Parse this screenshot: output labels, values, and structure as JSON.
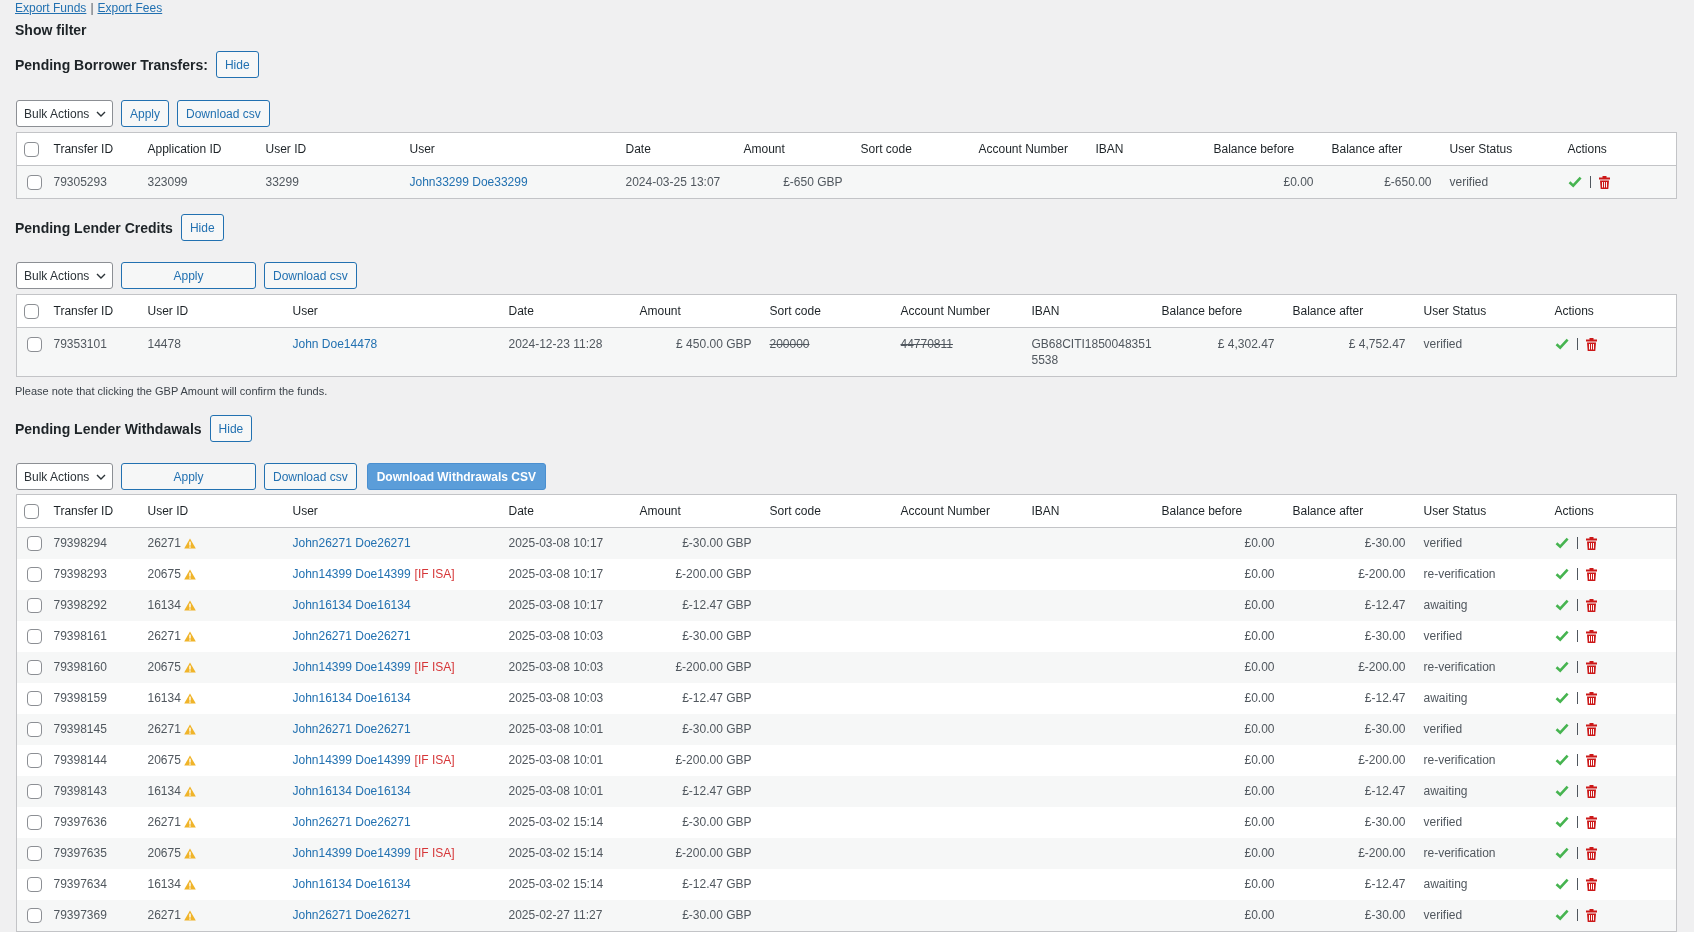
{
  "export_links": {
    "items": [
      "Export Funds",
      "Export Fees"
    ],
    "separator": "|"
  },
  "filter_toggle": "Show filter",
  "sections": [
    {
      "title": "Pending Borrower Transfers:",
      "hide_button": "Hide",
      "bulk_actions": "Bulk Actions",
      "buttons": [
        {
          "label": "Apply",
          "kind": "apply"
        },
        {
          "label": "Download csv",
          "kind": "download"
        }
      ],
      "table": {
        "select_all_checked": false,
        "columns": [
          "Transfer ID",
          "Application ID",
          "User ID",
          "User",
          "Date",
          "Amount",
          "Sort code",
          "Account Number",
          "IBAN",
          "Balance before",
          "Balance after",
          "User Status",
          "Actions"
        ],
        "rows": [
          {
            "checked": false,
            "transfer_id": "79305293",
            "application_id": "323099",
            "user_id": "33299",
            "user": "John33299 Doe33299",
            "date": "2024-03-25 13:07",
            "amount": "£-650 GBP",
            "balance_before": "£0.00",
            "balance_after": "£-650.00",
            "status": "verified"
          }
        ]
      }
    },
    {
      "title": "Pending Lender Credits",
      "hide_button": "Hide",
      "bulk_actions": "Bulk Actions",
      "buttons": [
        {
          "label": "Apply",
          "kind": "apply"
        },
        {
          "label": "Download csv",
          "kind": "download"
        }
      ],
      "table": {
        "select_all_checked": false,
        "columns": [
          "Transfer ID",
          "User ID",
          "User",
          "Date",
          "Amount",
          "Sort code",
          "Account Number",
          "IBAN",
          "Balance before",
          "Balance after",
          "User Status",
          "Actions"
        ],
        "rows": [
          {
            "checked": false,
            "transfer_id": "79353101",
            "user_id": "14478",
            "user": "John Doe14478",
            "date": "2024-12-23 11:28",
            "amount": "£ 450.00 GBP",
            "sort_code": "200000",
            "sort_code_struck": true,
            "account_number": "44770811",
            "account_number_struck": true,
            "iban": "GB68CITI18500483515538",
            "balance_before": "£ 4,302.47",
            "balance_after": "£ 4,752.47",
            "status": "verified"
          }
        ]
      },
      "note": "Please note that clicking the GBP Amount will confirm the funds."
    },
    {
      "title": "Pending Lender Withdawals",
      "hide_button": "Hide",
      "bulk_actions": "Bulk Actions",
      "buttons": [
        {
          "label": "Apply",
          "kind": "apply"
        },
        {
          "label": "Download csv",
          "kind": "download"
        },
        {
          "label": "Download Withdrawals CSV",
          "kind": "download_primary"
        }
      ],
      "table": {
        "select_all_checked": false,
        "columns": [
          "Transfer ID",
          "User ID",
          "User",
          "Date",
          "Amount",
          "Sort code",
          "Account Number",
          "IBAN",
          "Balance before",
          "Balance after",
          "User Status",
          "Actions"
        ],
        "rows": [
          {
            "checked": false,
            "transfer_id": "79398294",
            "user_id": "26271",
            "user_id_warning": true,
            "user": "John26271 Doe26271",
            "date": "2025-03-08 10:17",
            "amount": "£-30.00 GBP",
            "balance_before": "£0.00",
            "balance_after": "£-30.00",
            "status": "verified"
          },
          {
            "checked": false,
            "transfer_id": "79398293",
            "user_id": "20675",
            "user_id_warning": true,
            "user": "John14399 Doe14399",
            "user_tag": "[IF ISA]",
            "date": "2025-03-08 10:17",
            "amount": "£-200.00 GBP",
            "balance_before": "£0.00",
            "balance_after": "£-200.00",
            "status": "re-verification"
          },
          {
            "checked": false,
            "transfer_id": "79398292",
            "user_id": "16134",
            "user_id_warning": true,
            "user": "John16134 Doe16134",
            "date": "2025-03-08 10:17",
            "amount": "£-12.47 GBP",
            "balance_before": "£0.00",
            "balance_after": "£-12.47",
            "status": "awaiting"
          },
          {
            "checked": false,
            "transfer_id": "79398161",
            "user_id": "26271",
            "user_id_warning": true,
            "user": "John26271 Doe26271",
            "date": "2025-03-08 10:03",
            "amount": "£-30.00 GBP",
            "balance_before": "£0.00",
            "balance_after": "£-30.00",
            "status": "verified"
          },
          {
            "checked": false,
            "transfer_id": "79398160",
            "user_id": "20675",
            "user_id_warning": true,
            "user": "John14399 Doe14399",
            "user_tag": "[IF ISA]",
            "date": "2025-03-08 10:03",
            "amount": "£-200.00 GBP",
            "balance_before": "£0.00",
            "balance_after": "£-200.00",
            "status": "re-verification"
          },
          {
            "checked": false,
            "transfer_id": "79398159",
            "user_id": "16134",
            "user_id_warning": true,
            "user": "John16134 Doe16134",
            "date": "2025-03-08 10:03",
            "amount": "£-12.47 GBP",
            "balance_before": "£0.00",
            "balance_after": "£-12.47",
            "status": "awaiting"
          },
          {
            "checked": false,
            "transfer_id": "79398145",
            "user_id": "26271",
            "user_id_warning": true,
            "user": "John26271 Doe26271",
            "date": "2025-03-08 10:01",
            "amount": "£-30.00 GBP",
            "balance_before": "£0.00",
            "balance_after": "£-30.00",
            "status": "verified"
          },
          {
            "checked": false,
            "transfer_id": "79398144",
            "user_id": "20675",
            "user_id_warning": true,
            "user": "John14399 Doe14399",
            "user_tag": "[IF ISA]",
            "date": "2025-03-08 10:01",
            "amount": "£-200.00 GBP",
            "balance_before": "£0.00",
            "balance_after": "£-200.00",
            "status": "re-verification"
          },
          {
            "checked": false,
            "transfer_id": "79398143",
            "user_id": "16134",
            "user_id_warning": true,
            "user": "John16134 Doe16134",
            "date": "2025-03-08 10:01",
            "amount": "£-12.47 GBP",
            "balance_before": "£0.00",
            "balance_after": "£-12.47",
            "status": "awaiting"
          },
          {
            "checked": false,
            "transfer_id": "79397636",
            "user_id": "26271",
            "user_id_warning": true,
            "user": "John26271 Doe26271",
            "date": "2025-03-02 15:14",
            "amount": "£-30.00 GBP",
            "balance_before": "£0.00",
            "balance_after": "£-30.00",
            "status": "verified"
          },
          {
            "checked": false,
            "transfer_id": "79397635",
            "user_id": "20675",
            "user_id_warning": true,
            "user": "John14399 Doe14399",
            "user_tag": "[IF ISA]",
            "date": "2025-03-02 15:14",
            "amount": "£-200.00 GBP",
            "balance_before": "£0.00",
            "balance_after": "£-200.00",
            "status": "re-verification"
          },
          {
            "checked": false,
            "transfer_id": "79397634",
            "user_id": "16134",
            "user_id_warning": true,
            "user": "John16134 Doe16134",
            "date": "2025-03-02 15:14",
            "amount": "£-12.47 GBP",
            "balance_before": "£0.00",
            "balance_after": "£-12.47",
            "status": "awaiting"
          },
          {
            "checked": false,
            "transfer_id": "79397369",
            "user_id": "26271",
            "user_id_warning": true,
            "user": "John26271 Doe26271",
            "date": "2025-02-27 11:27",
            "amount": "£-30.00 GBP",
            "balance_before": "£0.00",
            "balance_after": "£-30.00",
            "status": "verified"
          }
        ]
      }
    }
  ]
}
